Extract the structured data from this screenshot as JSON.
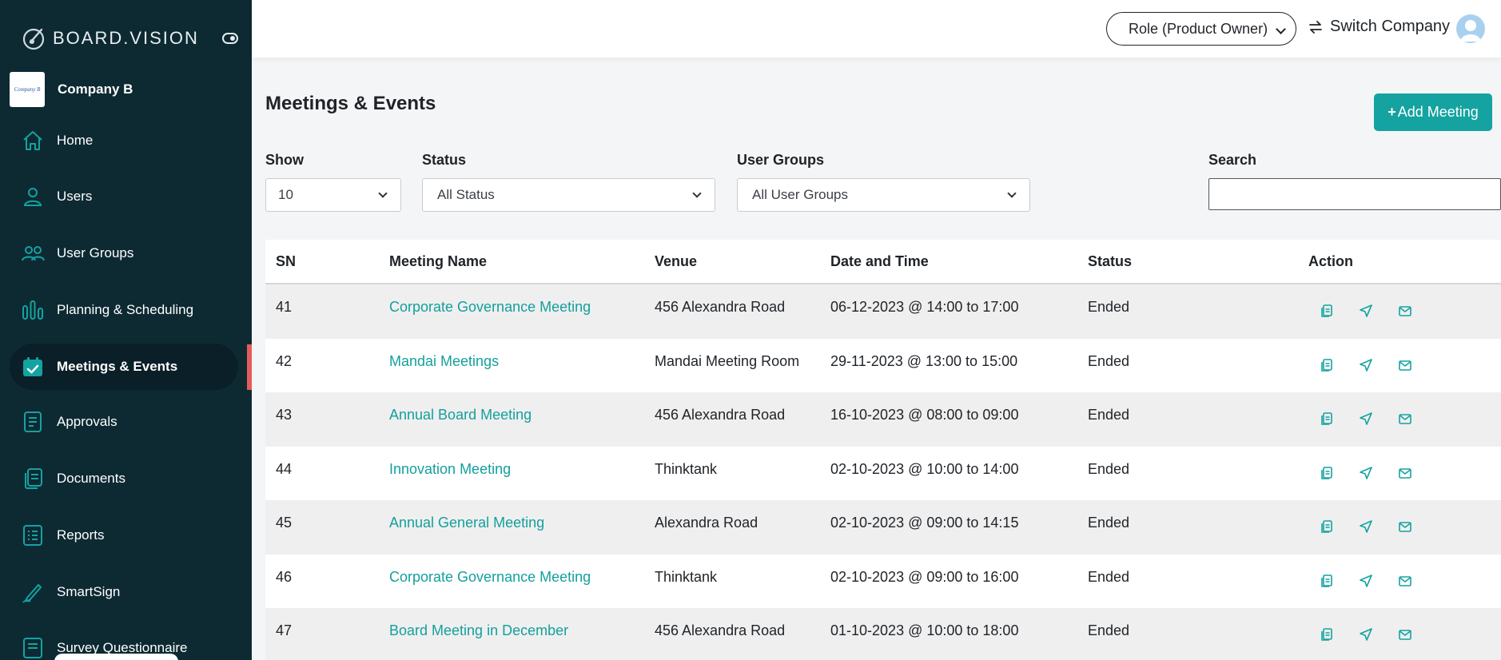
{
  "brand": {
    "name": "BOARD.VISION"
  },
  "company": {
    "logo_text": "Company B",
    "name": "Company B"
  },
  "sidebar": {
    "items": [
      {
        "label": "Home",
        "icon": "home-icon"
      },
      {
        "label": "Users",
        "icon": "user-icon"
      },
      {
        "label": "User Groups",
        "icon": "users-icon"
      },
      {
        "label": "Planning & Scheduling",
        "icon": "bar-chart-icon"
      },
      {
        "label": "Meetings & Events",
        "icon": "calendar-check-icon",
        "active": true
      },
      {
        "label": "Approvals",
        "icon": "approvals-icon"
      },
      {
        "label": "Documents",
        "icon": "documents-icon"
      },
      {
        "label": "Reports",
        "icon": "reports-icon"
      },
      {
        "label": "SmartSign",
        "icon": "pen-icon"
      },
      {
        "label": "Survey Questionnaire",
        "icon": "survey-icon"
      }
    ]
  },
  "header": {
    "role_label": "Role (Product Owner)",
    "switch_label": "Switch Company"
  },
  "main": {
    "title": "Meetings & Events",
    "add_button": "Add Meeting",
    "filters": {
      "show_label": "Show",
      "show_value": "10",
      "status_label": "Status",
      "status_value": "All Status",
      "groups_label": "User Groups",
      "groups_value": "All User Groups",
      "search_label": "Search",
      "search_value": ""
    },
    "table": {
      "headers": [
        "SN",
        "Meeting Name",
        "Venue",
        "Date and Time",
        "Status",
        "Action"
      ],
      "rows": [
        {
          "sn": "41",
          "name": "Corporate Governance Meeting",
          "venue": "456 Alexandra Road",
          "datetime": "06-12-2023 @ 14:00 to 17:00",
          "status": "Ended"
        },
        {
          "sn": "42",
          "name": "Mandai Meetings",
          "venue": "Mandai Meeting Room",
          "datetime": "29-11-2023 @ 13:00 to 15:00",
          "status": "Ended"
        },
        {
          "sn": "43",
          "name": "Annual Board Meeting",
          "venue": "456 Alexandra Road",
          "datetime": "16-10-2023 @ 08:00 to 09:00",
          "status": "Ended"
        },
        {
          "sn": "44",
          "name": "Innovation Meeting",
          "venue": "Thinktank",
          "datetime": "02-10-2023 @ 10:00 to 14:00",
          "status": "Ended"
        },
        {
          "sn": "45",
          "name": "Annual General Meeting",
          "venue": "Alexandra Road",
          "datetime": "02-10-2023 @ 09:00 to 14:15",
          "status": "Ended"
        },
        {
          "sn": "46",
          "name": "Corporate Governance Meeting",
          "venue": "Thinktank",
          "datetime": "02-10-2023 @ 09:00 to 16:00",
          "status": "Ended"
        },
        {
          "sn": "47",
          "name": "Board Meeting in December",
          "venue": "456 Alexandra Road",
          "datetime": "01-10-2023 @ 10:00 to 18:00",
          "status": "Ended"
        }
      ]
    }
  },
  "colors": {
    "sidebar_bg": "#0d2a33",
    "accent": "#14a3a0",
    "active_indicator": "#e35b5b"
  }
}
